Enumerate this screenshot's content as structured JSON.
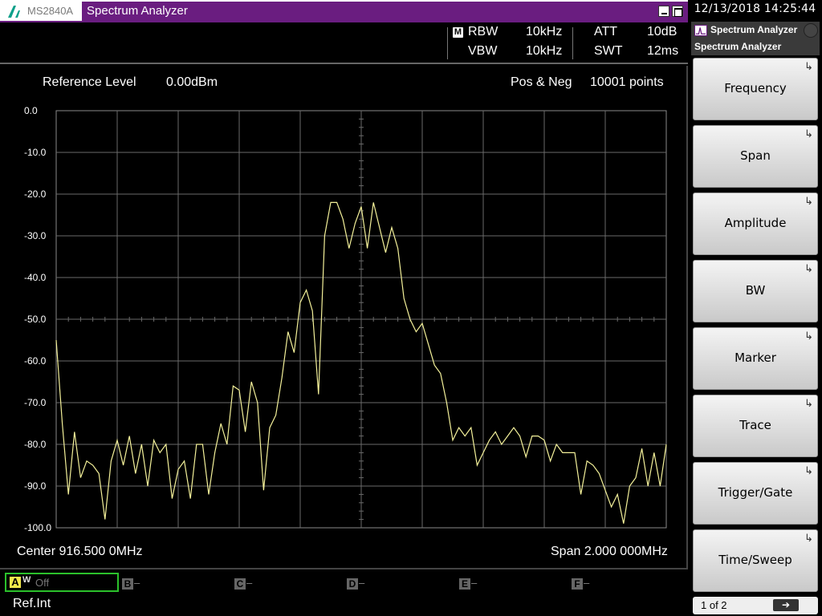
{
  "window": {
    "model": "MS2840A",
    "title": "Spectrum Analyzer"
  },
  "params": {
    "rbw_label": "RBW",
    "rbw_value": "10kHz",
    "vbw_label": "VBW",
    "vbw_value": "10kHz",
    "att_label": "ATT",
    "att_value": "10dB",
    "swt_label": "SWT",
    "swt_value": "12ms",
    "m_badge": "M"
  },
  "graph": {
    "ref_label": "Reference Level",
    "ref_value": "0.00dBm",
    "detector": "Pos & Neg",
    "points": "10001 points",
    "center": "Center 916.500 0MHz",
    "span": "Span 2.000 000MHz"
  },
  "chart_data": {
    "type": "line",
    "y_ticks": [
      "0.0",
      "-10.0",
      "-20.0",
      "-30.0",
      "-40.0",
      "-50.0",
      "-60.0",
      "-70.0",
      "-80.0",
      "-90.0",
      "-100.0"
    ],
    "ylim": [
      -100,
      0
    ],
    "xlim": [
      915.5,
      917.5
    ],
    "grid": true,
    "trace_color": "#f4f19a",
    "series": [
      {
        "x": [
          915.5,
          915.52,
          915.54,
          915.56,
          915.58,
          915.6,
          915.62,
          915.64,
          915.66,
          915.68,
          915.7,
          915.72,
          915.74,
          915.76,
          915.78,
          915.8,
          915.82,
          915.84,
          915.86,
          915.88,
          915.9,
          915.92,
          915.94,
          915.96,
          915.98,
          916.0,
          916.02,
          916.04,
          916.06,
          916.08,
          916.1,
          916.12,
          916.14,
          916.16,
          916.18,
          916.2,
          916.22,
          916.24,
          916.26,
          916.28,
          916.3,
          916.32,
          916.34,
          916.36,
          916.38,
          916.4,
          916.42,
          916.44,
          916.46,
          916.48,
          916.5,
          916.52,
          916.54,
          916.56,
          916.58,
          916.6,
          916.62,
          916.64,
          916.66,
          916.68,
          916.7,
          916.72,
          916.74,
          916.76,
          916.78,
          916.8,
          916.82,
          916.84,
          916.86,
          916.88,
          916.9,
          916.92,
          916.94,
          916.96,
          916.98,
          917.0,
          917.02,
          917.04,
          917.06,
          917.08,
          917.1,
          917.12,
          917.14,
          917.16,
          917.18,
          917.2,
          917.22,
          917.24,
          917.26,
          917.28,
          917.3,
          917.32,
          917.34,
          917.36,
          917.38,
          917.4,
          917.42,
          917.44,
          917.46,
          917.48,
          917.5
        ],
        "y": [
          -55,
          -75,
          -92,
          -77,
          -88,
          -84,
          -85,
          -87,
          -98,
          -84,
          -79,
          -85,
          -78,
          -87,
          -80,
          -90,
          -79,
          -82,
          -80,
          -93,
          -86,
          -84,
          -93,
          -80,
          -80,
          -92,
          -82,
          -75,
          -80,
          -66,
          -67,
          -77,
          -65,
          -70,
          -91,
          -76,
          -73,
          -64,
          -53,
          -58,
          -46,
          -43,
          -48,
          -68,
          -30,
          -22,
          -22,
          -26,
          -33,
          -27,
          -23,
          -33,
          -22,
          -28,
          -34,
          -28,
          -33,
          -45,
          -50,
          -53,
          -51,
          -56,
          -61,
          -63,
          -70,
          -79,
          -76,
          -78,
          -76,
          -85,
          -82,
          -79,
          -77,
          -80,
          -78,
          -76,
          -78,
          -83,
          -78,
          -78,
          -79,
          -84,
          -80,
          -82,
          -82,
          -82,
          -92,
          -84,
          -85,
          -87,
          -91,
          -95,
          -92,
          -99,
          -90,
          -88,
          -81,
          -90,
          -82,
          -90,
          -80
        ]
      }
    ]
  },
  "traces": {
    "a_letter": "A",
    "a_mode": "W",
    "a_state": "Off",
    "b": "B",
    "c": "C",
    "d": "D",
    "e": "E",
    "f": "F",
    "dash": "–"
  },
  "status": {
    "ref": "Ref.Int"
  },
  "clock": "12/13/2018 14:25:44",
  "menu": {
    "title": "Spectrum Analyzer",
    "subtitle": "Spectrum Analyzer",
    "keys": [
      "Frequency",
      "Span",
      "Amplitude",
      "BW",
      "Marker",
      "Trace",
      "Trigger/Gate",
      "Time/Sweep"
    ],
    "page": "1 of 2",
    "next": "➔"
  }
}
